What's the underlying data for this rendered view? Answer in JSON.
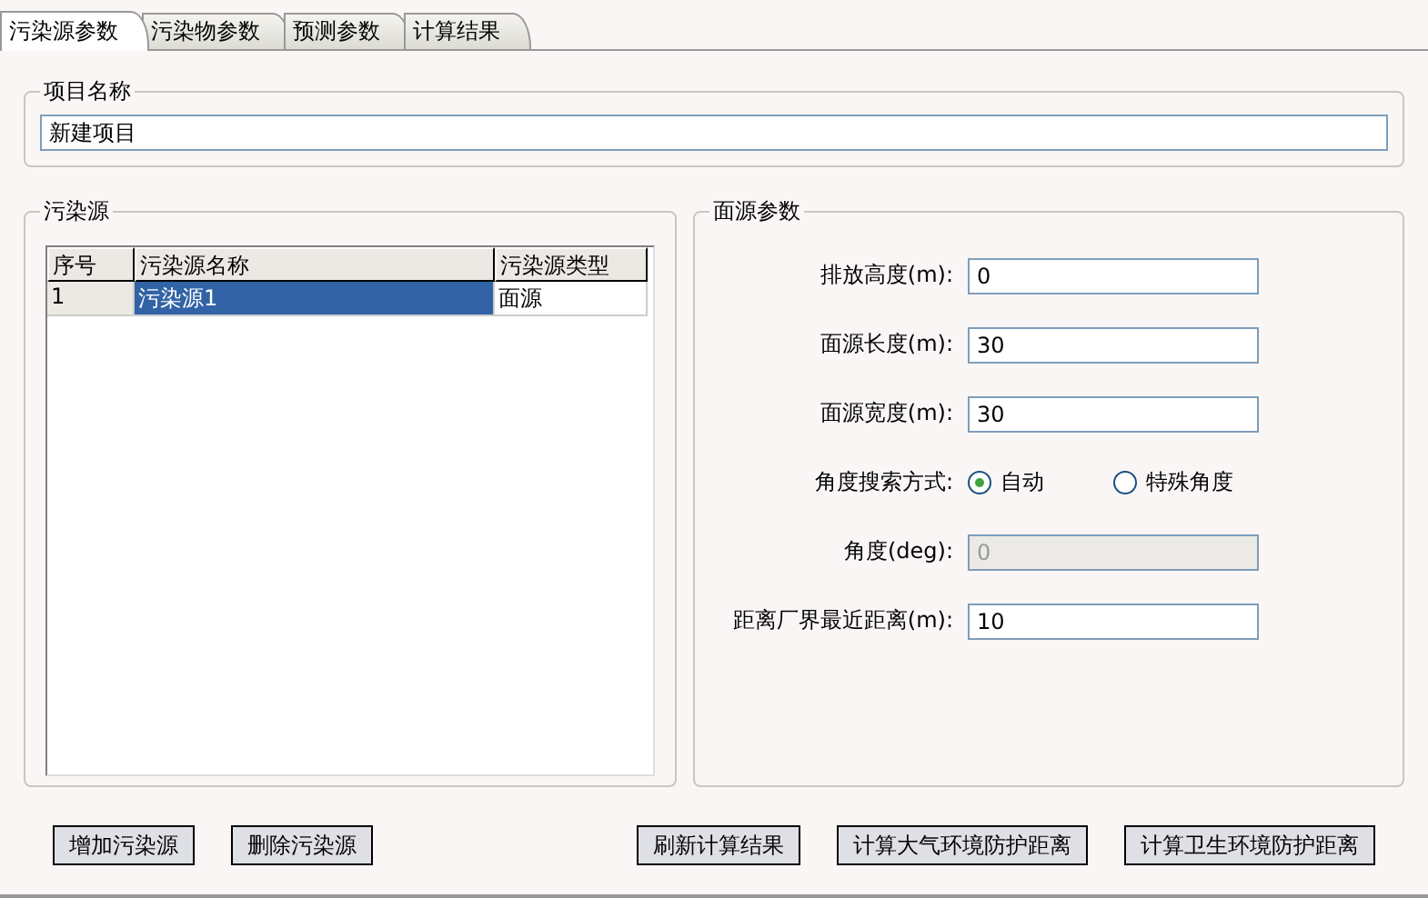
{
  "tabs": [
    {
      "label": "污染源参数",
      "selected": true
    },
    {
      "label": "污染物参数",
      "selected": false
    },
    {
      "label": "预测参数",
      "selected": false
    },
    {
      "label": "计算结果",
      "selected": false
    }
  ],
  "project": {
    "title": "项目名称",
    "value": "新建项目"
  },
  "sources": {
    "title": "污染源",
    "columns": [
      "序号",
      "污染源名称",
      "污染源类型"
    ],
    "rows": [
      {
        "cells": [
          "1",
          "污染源1",
          "面源"
        ],
        "selected": true
      }
    ]
  },
  "params": {
    "title": "面源参数",
    "fields": [
      {
        "kind": "input",
        "label": "排放高度(m):",
        "value": "0",
        "disabled": false
      },
      {
        "kind": "input",
        "label": "面源长度(m):",
        "value": "30",
        "disabled": false
      },
      {
        "kind": "input",
        "label": "面源宽度(m):",
        "value": "30",
        "disabled": false
      },
      {
        "kind": "radio",
        "label": "角度搜索方式:",
        "options": [
          {
            "label": "自动",
            "selected": true
          },
          {
            "label": "特殊角度",
            "selected": false
          }
        ]
      },
      {
        "kind": "input",
        "label": "角度(deg):",
        "value": "0",
        "disabled": true
      },
      {
        "kind": "input",
        "label": "距离厂界最近距离(m):",
        "value": "10",
        "disabled": false
      }
    ]
  },
  "left_buttons": [
    "增加污染源",
    "删除污染源"
  ],
  "right_buttons": [
    "刷新计算结果",
    "计算大气环境防护距离",
    "计算卫生环境防护距离"
  ]
}
